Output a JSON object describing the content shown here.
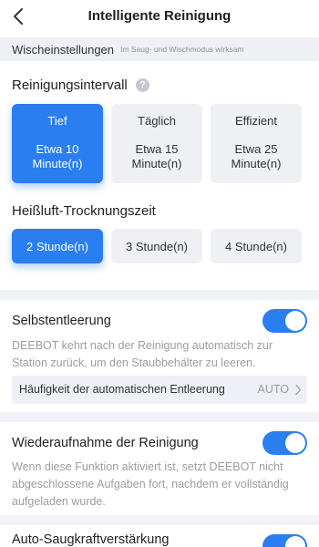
{
  "header": {
    "title": "Intelligente Reinigung",
    "back_icon": "chevron-left-icon"
  },
  "wisch": {
    "label": "Wischeinstellungen",
    "note": "Im Saug- und Wischmodus wirksam"
  },
  "interval": {
    "heading": "Reinigungsintervall",
    "help_glyph": "?",
    "options": [
      {
        "mode": "Tief",
        "duration": "Etwa 10 Minute(n)",
        "selected": true
      },
      {
        "mode": "Täglich",
        "duration": "Etwa 15 Minute(n)",
        "selected": false
      },
      {
        "mode": "Effizient",
        "duration": "Etwa 25 Minute(n)",
        "selected": false
      }
    ]
  },
  "drying": {
    "heading": "Heißluft-Trocknungszeit",
    "options": [
      {
        "label": "2 Stunde(n)",
        "selected": true
      },
      {
        "label": "3 Stunde(n)",
        "selected": false
      },
      {
        "label": "4 Stunde(n)",
        "selected": false
      }
    ]
  },
  "self_empty": {
    "title": "Selbstentleerung",
    "enabled": true,
    "description": "DEEBOT kehrt nach der Reinigung automatisch zur Station zurück, um den Staubbehälter zu leeren.",
    "frequency_label": "Häufigkeit der automatischen Entleerung",
    "frequency_value": "AUTO"
  },
  "resume": {
    "title": "Wiederaufnahme der Reinigung",
    "enabled": true,
    "description": "Wenn diese Funktion aktiviert ist, setzt DEEBOT nicht abgeschlossene Aufgaben fort, nachdem er vollständig aufgeladen wurde."
  },
  "suction_boost": {
    "title": "Auto-Saugkraftverstärkung",
    "enabled": true
  },
  "colors": {
    "accent": "#2a7ef0",
    "option_bg": "#eef0f3",
    "muted_text": "#9a9da4",
    "section_bg": "#f2f3f6"
  }
}
